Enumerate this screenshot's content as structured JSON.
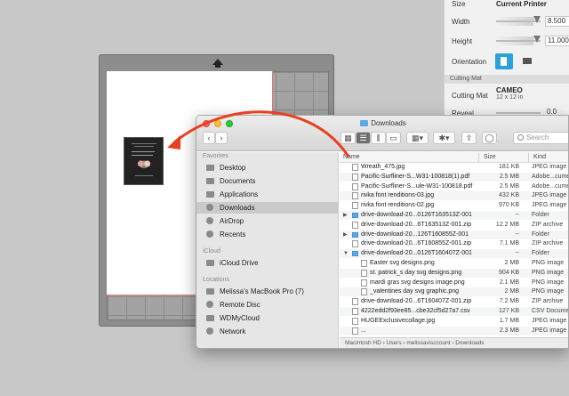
{
  "settings_panel": {
    "size_label": "Size",
    "size_value": "Current Printer",
    "width_label": "Width",
    "width_value": "8.500",
    "height_label": "Height",
    "height_value": "11.000",
    "orientation_label": "Orientation",
    "cutting_mat_section": "Cutting Mat",
    "cutting_mat_label": "Cutting Mat",
    "cutting_mat_value": "CAMEO",
    "cutting_mat_sub": "12 x 12 in",
    "reveal_label": "Reveal",
    "reveal_value": "0.0"
  },
  "finder": {
    "title": "Downloads",
    "search_placeholder": "Search",
    "sidebar": {
      "favorites_header": "Favorites",
      "favorites": [
        {
          "label": "Desktop",
          "icon": "desktop-icon"
        },
        {
          "label": "Documents",
          "icon": "document-icon"
        },
        {
          "label": "Applications",
          "icon": "applications-icon"
        },
        {
          "label": "Downloads",
          "icon": "downloads-icon"
        },
        {
          "label": "AirDrop",
          "icon": "airdrop-icon"
        },
        {
          "label": "Recents",
          "icon": "clock-icon"
        }
      ],
      "icloud_header": "iCloud",
      "icloud": [
        {
          "label": "iCloud Drive",
          "icon": "cloud-icon"
        }
      ],
      "locations_header": "Locations",
      "locations": [
        {
          "label": "Melissa's MacBook Pro (7)",
          "icon": "laptop-icon"
        },
        {
          "label": "Remote Disc",
          "icon": "disc-icon"
        },
        {
          "label": "WDMyCloud",
          "icon": "drive-icon"
        },
        {
          "label": "Network",
          "icon": "network-icon"
        }
      ]
    },
    "columns": {
      "name": "Name",
      "size": "Size",
      "kind": "Kind"
    },
    "files": [
      {
        "name": "Wreath_475.jpg",
        "size": "181 KB",
        "kind": "JPEG image",
        "type": "file"
      },
      {
        "name": "Pacific-Surfliner-S...W31-100818(1).pdf",
        "size": "2.5 MB",
        "kind": "Adobe...cument",
        "type": "file"
      },
      {
        "name": "Pacific-Surfliner-S...ule-W31-100818.pdf",
        "size": "2.5 MB",
        "kind": "Adobe...cument",
        "type": "file"
      },
      {
        "name": "rivka font renditions-03.jpg",
        "size": "432 KB",
        "kind": "JPEG image",
        "type": "file"
      },
      {
        "name": "rivka font renditions-02.jpg",
        "size": "970 KB",
        "kind": "JPEG image",
        "type": "file"
      },
      {
        "name": "drive-download-20...0126T163513Z-001",
        "size": "--",
        "kind": "Folder",
        "type": "folder"
      },
      {
        "name": "drive-download-20...6T163513Z-001.zip",
        "size": "12.2 MB",
        "kind": "ZIP archive",
        "type": "zip"
      },
      {
        "name": "drive-download-20...126T160855Z-001",
        "size": "--",
        "kind": "Folder",
        "type": "folder"
      },
      {
        "name": "drive-download-20...6T160855Z-001.zip",
        "size": "7.1 MB",
        "kind": "ZIP archive",
        "type": "zip"
      },
      {
        "name": "drive-download-20...0126T160407Z-001",
        "size": "--",
        "kind": "Folder",
        "type": "folder-open"
      },
      {
        "name": "Easter svg designs.png",
        "size": "2 MB",
        "kind": "PNG image",
        "type": "child"
      },
      {
        "name": "st. patrick_s day svg designs.png",
        "size": "904 KB",
        "kind": "PNG image",
        "type": "child"
      },
      {
        "name": "mardi gras svg designs image.png",
        "size": "2.1 MB",
        "kind": "PNG image",
        "type": "child"
      },
      {
        "name": "_valentines day svg graphic.png",
        "size": "2 MB",
        "kind": "PNG image",
        "type": "child"
      },
      {
        "name": "drive-download-20...6T160407Z-001.zip",
        "size": "7.2 MB",
        "kind": "ZIP archive",
        "type": "zip"
      },
      {
        "name": "4222edd2f93ee85...cbe32cf5d27a7.csv",
        "size": "127 KB",
        "kind": "CSV Document",
        "type": "file"
      },
      {
        "name": "HUGEExclusivecollage.jpg",
        "size": "1.7 MB",
        "kind": "JPEG image",
        "type": "file"
      },
      {
        "name": "...",
        "size": "2.3 MB",
        "kind": "JPEG image",
        "type": "file"
      }
    ],
    "pathbar": [
      "Macintosh HD",
      "Users",
      "melissavisccount",
      "Downloads"
    ]
  },
  "colors": {
    "accent": "#2aa3d8",
    "drag_arrow": "#e8401f",
    "folder": "#5aa9e6"
  }
}
